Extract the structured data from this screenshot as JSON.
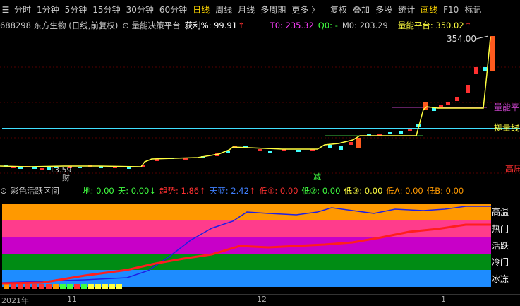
{
  "toolbar": {
    "items": [
      {
        "label": "分时",
        "active": false
      },
      {
        "label": "1分钟",
        "active": false
      },
      {
        "label": "5分钟",
        "active": false
      },
      {
        "label": "15分钟",
        "active": false
      },
      {
        "label": "30分钟",
        "active": false
      },
      {
        "label": "60分钟",
        "active": false
      },
      {
        "label": "日线",
        "active": true
      },
      {
        "label": "周线",
        "active": false
      },
      {
        "label": "月线",
        "active": false
      },
      {
        "label": "多周期",
        "active": false
      },
      {
        "label": "更多 〉",
        "active": false
      }
    ],
    "right_items": [
      {
        "label": "复权"
      },
      {
        "label": "叠加"
      },
      {
        "label": "多股"
      },
      {
        "label": "统计"
      },
      {
        "label": "画线",
        "active": true
      },
      {
        "label": "F10"
      },
      {
        "label": "标记"
      }
    ]
  },
  "info": {
    "code_name": "688298 东方生物 (日线,前复权)",
    "indicator": "量能决策平台",
    "profit_label": "获利%: 99.91",
    "t0": "T0: 235.32",
    "q0": "Q0: -",
    "m0": "M0: 203.29",
    "platform": "量能平台: 350.02"
  },
  "main_chart": {
    "high_label": "354.00",
    "labels": {
      "liangneng": "量能平",
      "yuancheng": "拠量线",
      "gao": "高届",
      "cai": "财",
      "jian": "减",
      "low_label": "13.59"
    }
  },
  "sub": {
    "title": "彩色活跃区间",
    "di": "地: 0.00",
    "tian": "天: 0.00",
    "qushi": "趋势: 1.86",
    "tianlan": "天蓝: 2.42",
    "di1": "低①: 0.00",
    "di2": "低②: 0.00",
    "di3": "低③: 0.00",
    "dia": "低A: 0.00",
    "dib": "低B: 0.00",
    "zones": [
      "高温",
      "热门",
      "活跃",
      "冷门",
      "冰冻"
    ]
  },
  "xaxis": {
    "labels": [
      "2021年",
      "11",
      "12",
      "1"
    ]
  },
  "colors": {
    "up": "#ff3030",
    "down": "#40ffff",
    "yellow": "#ffff40",
    "zone_high": "#ff9900",
    "zone_hot": "#ff3c8c",
    "zone_active": "#c800c8",
    "zone_cold": "#008c14",
    "zone_frozen": "#1e8cff"
  }
}
